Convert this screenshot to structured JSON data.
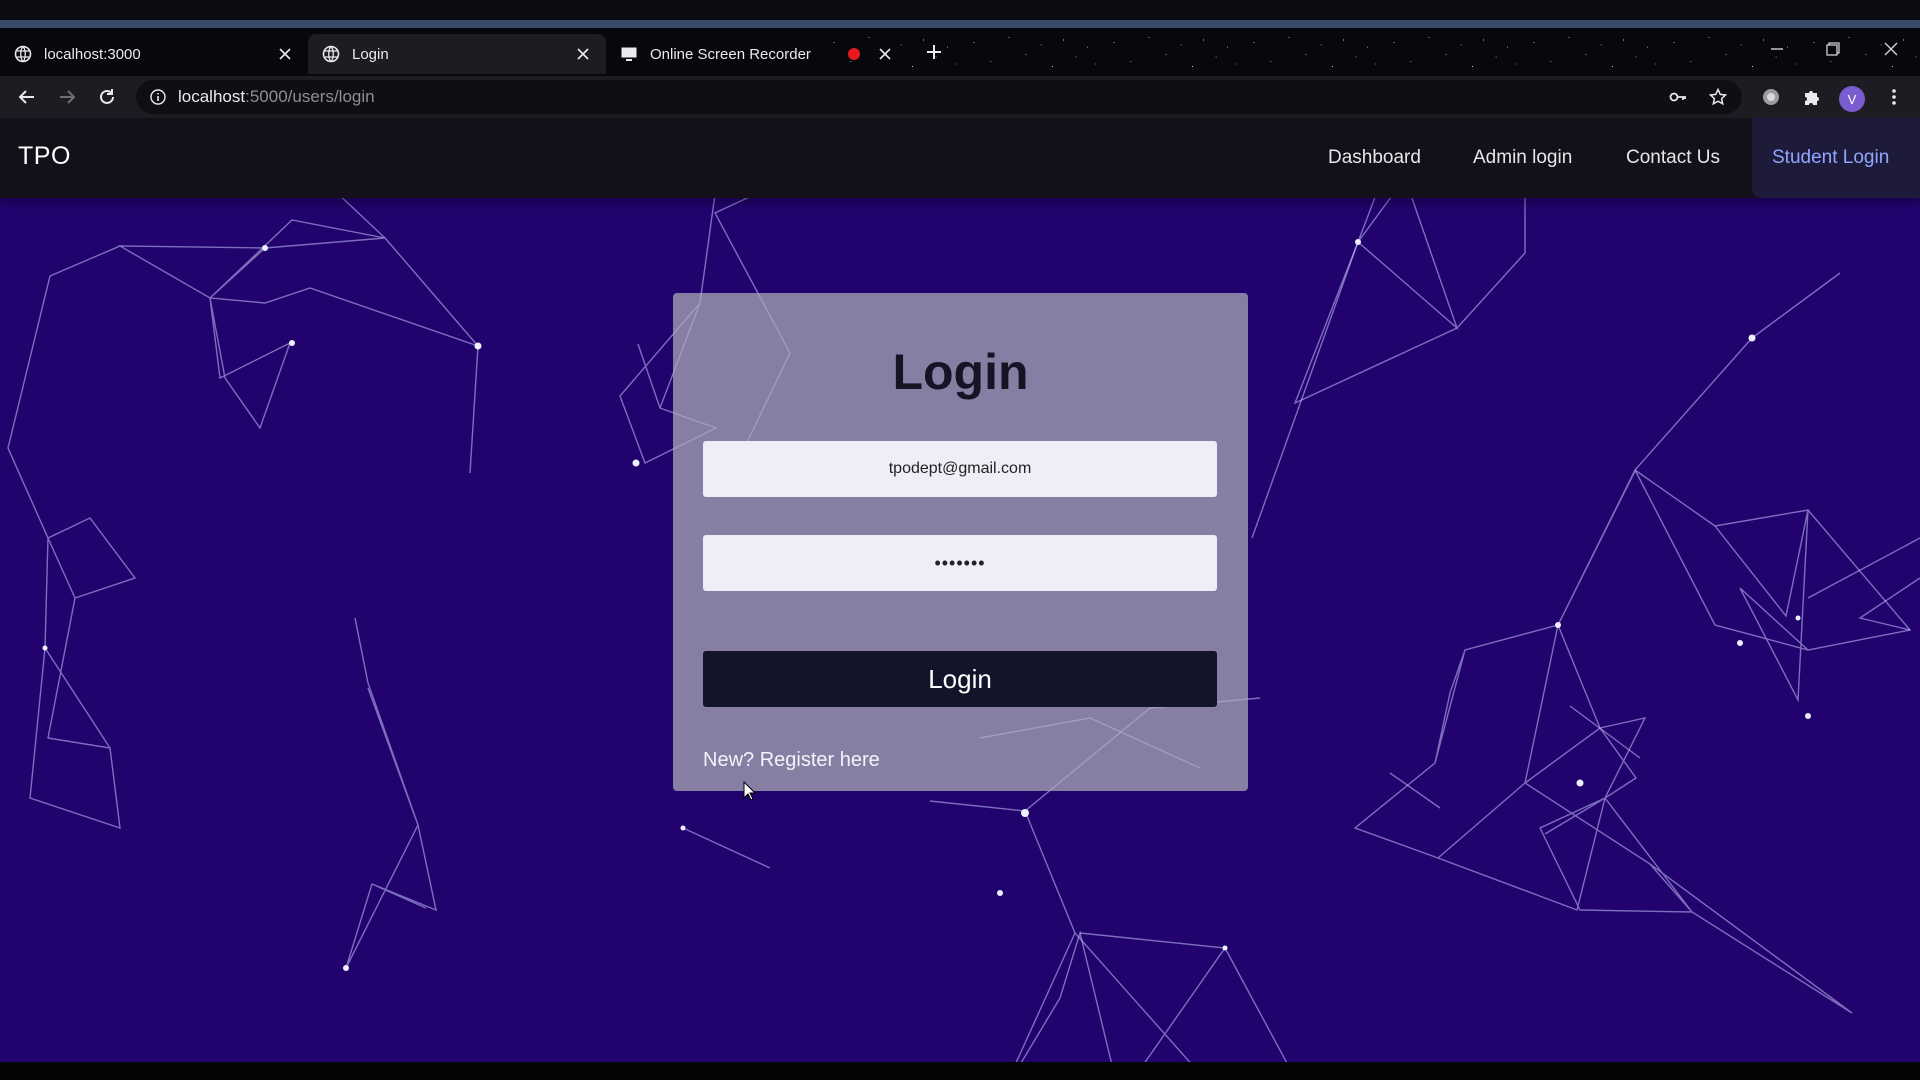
{
  "browser": {
    "tabs": [
      {
        "title": "localhost:3000",
        "favicon": "globe-icon",
        "active": false
      },
      {
        "title": "Login",
        "favicon": "globe-icon",
        "active": true
      },
      {
        "title": "Online Screen Recorder",
        "favicon": "monitor-icon",
        "active": false,
        "recording": true
      }
    ],
    "url_host": "localhost",
    "url_rest": ":5000/users/login",
    "profile_initial": "V",
    "icons": [
      "back-icon",
      "forward-icon",
      "reload-icon",
      "info-icon",
      "key-icon",
      "star-icon",
      "extension-icon",
      "puzzle-icon",
      "menu-icon"
    ]
  },
  "app": {
    "brand": "TPO",
    "nav": [
      {
        "label": "Dashboard",
        "active": false
      },
      {
        "label": "Admin login",
        "active": false
      },
      {
        "label": "Contact Us",
        "active": false
      },
      {
        "label": "Student Login",
        "active": true
      }
    ]
  },
  "login": {
    "title": "Login",
    "email_value": "tpodept@gmail.com",
    "password_masked": "•••••••",
    "button_label": "Login",
    "register_link": "New? Register here"
  },
  "colors": {
    "page_bg": "#22036e",
    "navbar_bg": "#141019",
    "active_nav": "#8fa7ff",
    "button_bg": "#13132a"
  }
}
